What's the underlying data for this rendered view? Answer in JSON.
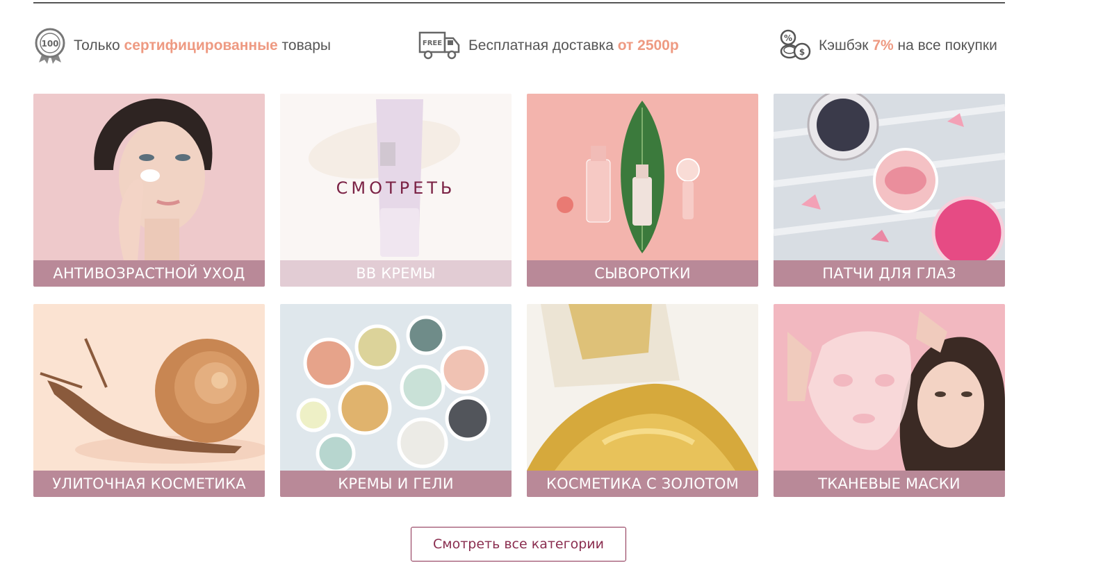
{
  "features": [
    {
      "icon": "quality-badge-icon",
      "before": "Только ",
      "highlight": "сертифицированные",
      "after": " товары"
    },
    {
      "icon": "free-delivery-truck-icon",
      "before": "Бесплатная доставка ",
      "highlight": "от 2500р",
      "after": ""
    },
    {
      "icon": "cashback-coins-icon",
      "before": "Кэшбэк ",
      "highlight": "7%",
      "after": " на все покупки"
    }
  ],
  "categories": [
    {
      "label": "АНТИВОЗРАСТНОЙ УХОД",
      "image": "woman-applying-cream"
    },
    {
      "label": "BB КРЕМЫ",
      "image": "bb-cream-tube",
      "hover_label": "СМОТРЕТЬ"
    },
    {
      "label": "СЫВОРОТКИ",
      "image": "serum-bottles-with-leaf"
    },
    {
      "label": "ПАТЧИ ДЛЯ ГЛАЗ",
      "image": "eye-patch-jars"
    },
    {
      "label": "УЛИТОЧНАЯ КОСМЕТИКА",
      "image": "snail"
    },
    {
      "label": "КРЕМЫ И ГЕЛИ",
      "image": "cream-jars"
    },
    {
      "label": "КОСМЕТИКА С ЗОЛОТОМ",
      "image": "gold-flakes"
    },
    {
      "label": "ТКАНЕВЫЕ МАСКИ",
      "image": "woman-with-sheet-mask"
    }
  ],
  "badge_text": "100",
  "truck_text": "FREE",
  "all_categories_button": "Смотреть все категории",
  "colors": {
    "accent": "#ee9a82",
    "brand": "#8a2d4f",
    "caption_bg": "#9e5c70"
  }
}
